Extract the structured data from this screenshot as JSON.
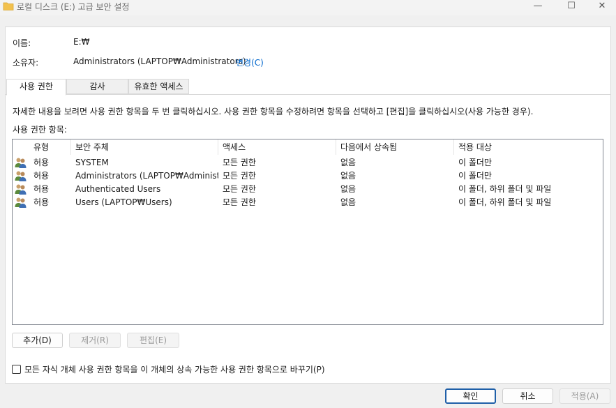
{
  "window": {
    "title": "로컬 디스크 (E:) 고급 보안 설정",
    "minimize_glyph": "—",
    "maximize_glyph": "☐",
    "close_glyph": "✕"
  },
  "info": {
    "name_label": "이름:",
    "name_value": "E:₩",
    "owner_label": "소유자:",
    "owner_value": "Administrators (LAPTOP₩Administrators)",
    "change_link": "변경(C)"
  },
  "tabs": [
    {
      "label": "사용 권한",
      "active": true
    },
    {
      "label": "감사",
      "active": false
    },
    {
      "label": "유효한 액세스",
      "active": false
    }
  ],
  "permissions": {
    "instructions": "자세한 내용을 보려면 사용 권한 항목을 두 번 클릭하십시오. 사용 권한 항목을 수정하려면 항목을 선택하고 [편집]을 클릭하십시오(사용 가능한 경우).",
    "entries_label": "사용 권한 항목:",
    "columns": [
      "유형",
      "보안 주체",
      "액세스",
      "다음에서 상속됨",
      "적용 대상"
    ],
    "rows": [
      {
        "type": "허용",
        "principal": "SYSTEM",
        "access": "모든 권한",
        "inherited": "없음",
        "applies": "이 폴더만"
      },
      {
        "type": "허용",
        "principal": "Administrators (LAPTOP₩Administr...",
        "access": "모든 권한",
        "inherited": "없음",
        "applies": "이 폴더만"
      },
      {
        "type": "허용",
        "principal": "Authenticated Users",
        "access": "모든 권한",
        "inherited": "없음",
        "applies": "이 폴더, 하위 폴더 및 파일"
      },
      {
        "type": "허용",
        "principal": "Users (LAPTOP₩Users)",
        "access": "모든 권한",
        "inherited": "없음",
        "applies": "이 폴더, 하위 폴더 및 파일"
      }
    ],
    "add_button": "추가(D)",
    "remove_button": "제거(R)",
    "edit_button": "편집(E)",
    "replace_checkbox_label": "모든 자식 개체 사용 권한 항목을 이 개체의 상속 가능한 사용 권한 항목으로 바꾸기(P)",
    "replace_checkbox_checked": false
  },
  "footer": {
    "ok": "확인",
    "cancel": "취소",
    "apply": "적용(A)"
  },
  "colors": {
    "link": "#0066cc",
    "primary_border": "#1f5fa8",
    "folder": "#f2c14e"
  }
}
